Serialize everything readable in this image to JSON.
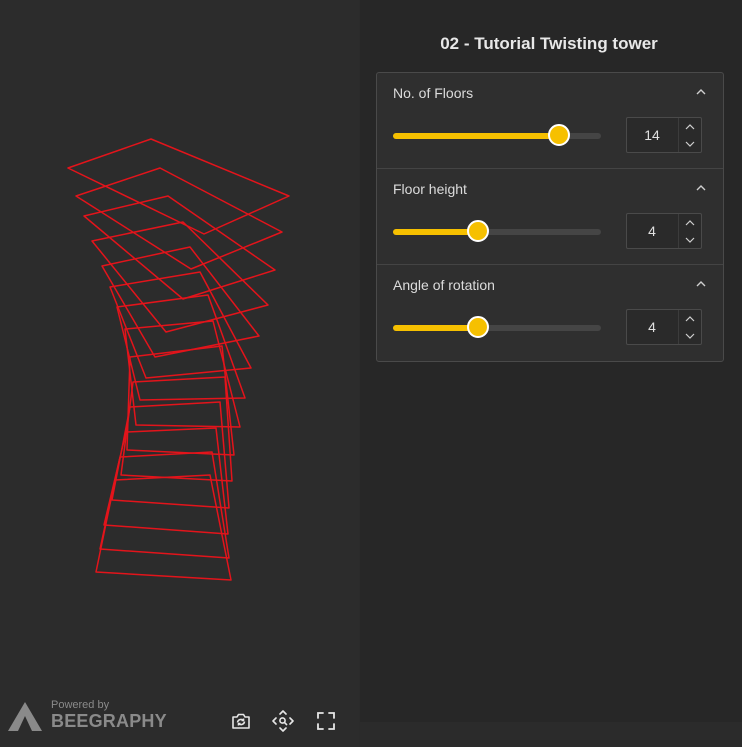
{
  "title": "02 - Tutorial Twisting tower",
  "parameters": [
    {
      "label": "No. of Floors",
      "value": "14",
      "fraction": 0.8
    },
    {
      "label": "Floor height",
      "value": "4",
      "fraction": 0.41
    },
    {
      "label": "Angle of rotation",
      "value": "4",
      "fraction": 0.41
    }
  ],
  "branding": {
    "powered_by": "Powered by",
    "name": "BEEGRAPHY"
  },
  "viewport_tools": [
    "camera-switch-icon",
    "zoom-extents-icon",
    "fullscreen-icon"
  ],
  "colors": {
    "accent": "#f6c000",
    "geometry": "#e3141b",
    "panel_bg": "#272727",
    "viewport_bg": "#2c2c2c"
  },
  "tower": {
    "floors": 14
  }
}
